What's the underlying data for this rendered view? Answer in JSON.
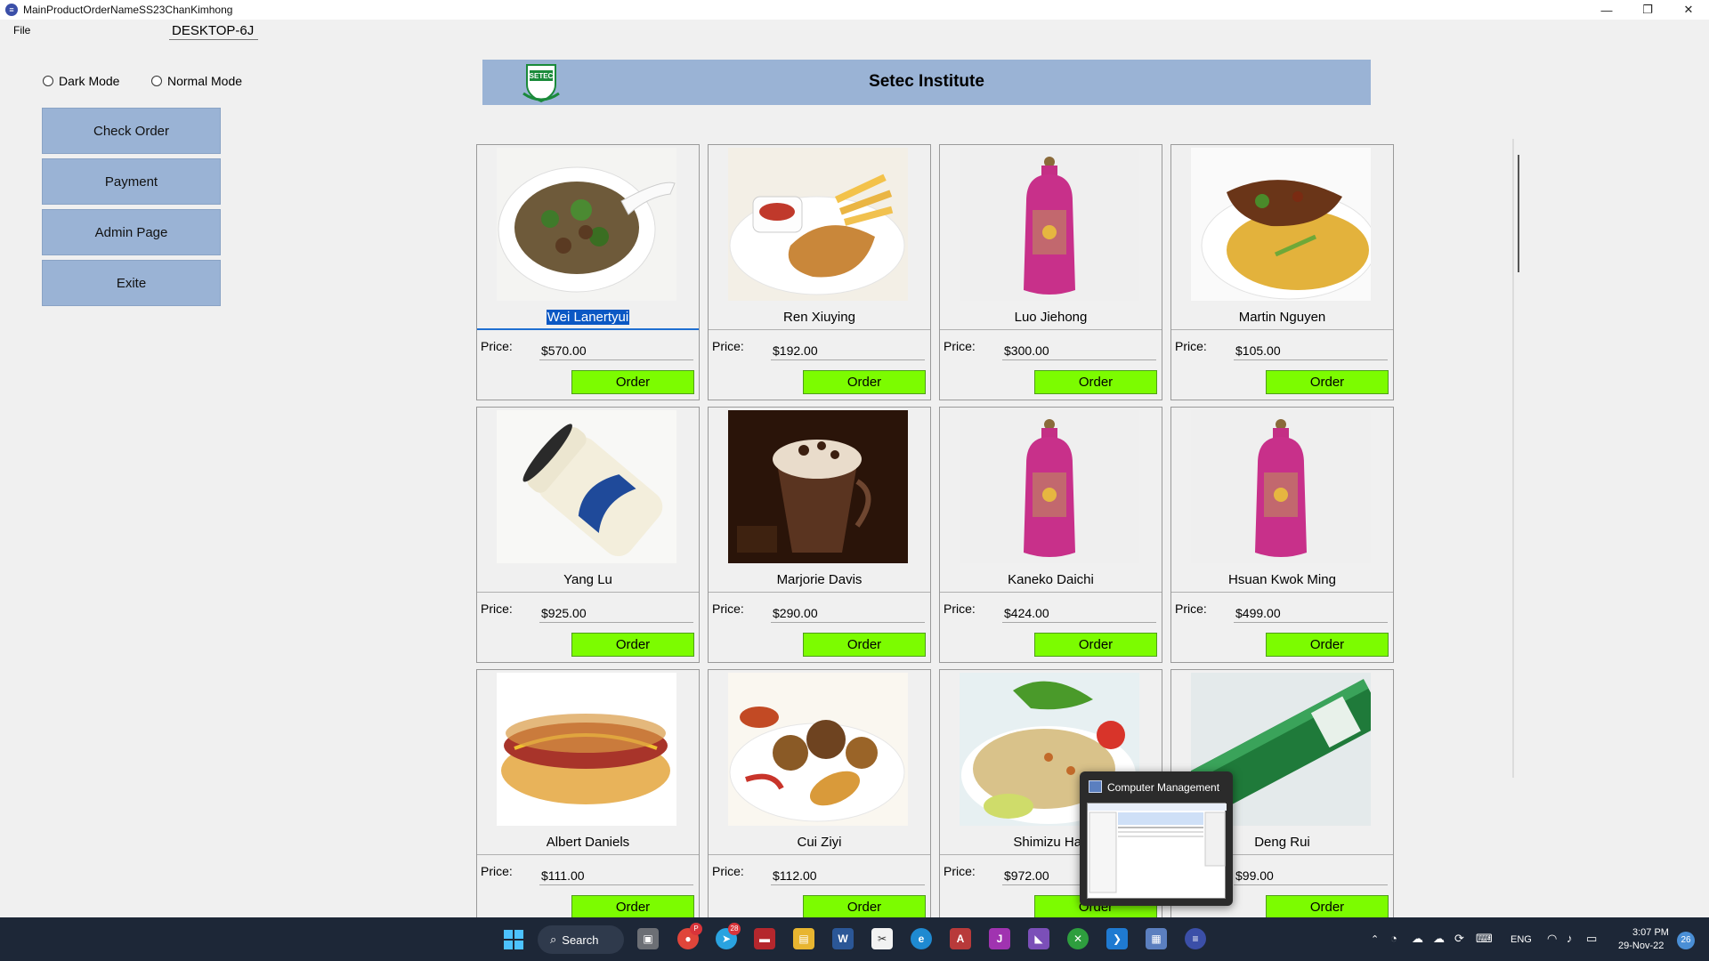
{
  "window": {
    "title": "MainProductOrderNameSS23ChanKimhong",
    "controls": [
      "minimize-icon",
      "restore-icon",
      "close-icon"
    ]
  },
  "menu": {
    "file": "File",
    "host": "DESKTOP-6J"
  },
  "modes": {
    "dark": "Dark Mode",
    "normal": "Normal Mode"
  },
  "sidebar": {
    "check_order": "Check Order",
    "payment": "Payment",
    "admin": "Admin Page",
    "exit": "Exite"
  },
  "banner": {
    "title": "Setec Institute",
    "logo_text": "SETEC"
  },
  "price_label": "Price:",
  "order_label": "Order",
  "products": [
    {
      "name": "Wei Lanertyui",
      "price": "$570.00",
      "image": "noodle-soup"
    },
    {
      "name": "Ren Xiuying",
      "price": "$192.00",
      "image": "fried-chicken"
    },
    {
      "name": "Luo Jiehong",
      "price": "$300.00",
      "image": "pink-bottle"
    },
    {
      "name": "Martin Nguyen",
      "price": "$105.00",
      "image": "fried-noodles"
    },
    {
      "name": "Yang Lu",
      "price": "$925.00",
      "image": "shampoo-bottle"
    },
    {
      "name": "Marjorie Davis",
      "price": "$290.00",
      "image": "chocolate-drink"
    },
    {
      "name": "Kaneko Daichi",
      "price": "$424.00",
      "image": "pink-bottle"
    },
    {
      "name": "Hsuan Kwok Ming",
      "price": "$499.00",
      "image": "pink-bottle"
    },
    {
      "name": "Albert Daniels",
      "price": "$111.00",
      "image": "hot-dog"
    },
    {
      "name": "Cui Ziyi",
      "price": "$112.00",
      "image": "fried-food-plate"
    },
    {
      "name": "Shimizu Haz",
      "price": "$972.00",
      "image": "fried-rice"
    },
    {
      "name": "Deng Rui",
      "price": "$99.00",
      "image": "toothpaste"
    }
  ],
  "popup": {
    "title": "Computer Management"
  },
  "taskbar": {
    "search": "Search",
    "chrome_badge": "P",
    "telegram_badge": "28",
    "lang": "ENG",
    "time": "3:07 PM",
    "date": "29-Nov-22",
    "notification_count": "26"
  },
  "colors": {
    "button_blue": "#9ab3d5",
    "order_green": "#7cfc00",
    "taskbar": "#1d2737",
    "selection": "#0b58c4"
  }
}
